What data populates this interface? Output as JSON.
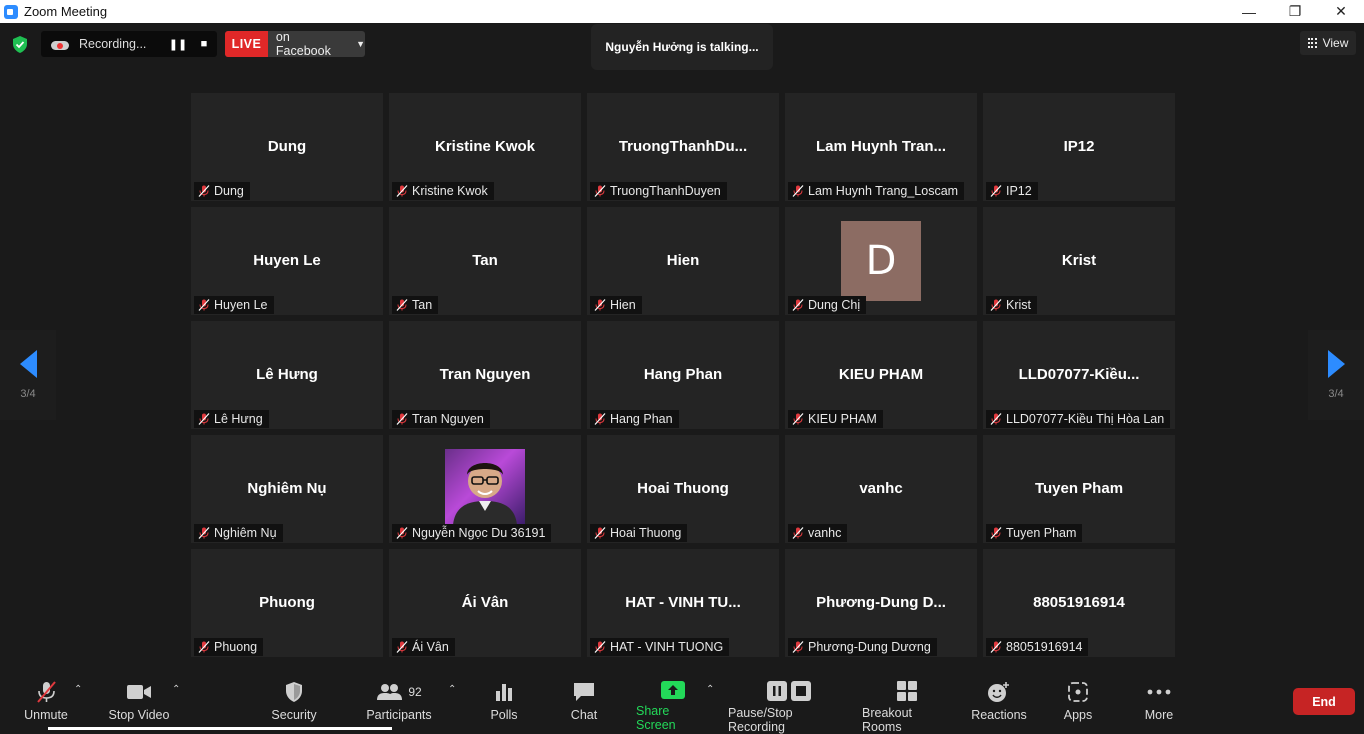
{
  "window": {
    "title": "Zoom Meeting"
  },
  "recording": {
    "label": "Recording..."
  },
  "live": {
    "tag": "LIVE",
    "destination": "on Facebook"
  },
  "talking": {
    "text": "Nguyễn Hưởng is talking..."
  },
  "view": {
    "label": "View"
  },
  "pagination": {
    "left": "3/4",
    "right": "3/4"
  },
  "participants": [
    {
      "name": "Dung",
      "label": "Dung"
    },
    {
      "name": "Kristine Kwok",
      "label": "Kristine Kwok"
    },
    {
      "name": "TruongThanhDu...",
      "label": "TruongThanhDuyen"
    },
    {
      "name": "Lam  Huynh  Tran...",
      "label": "Lam Huynh Trang_Loscam"
    },
    {
      "name": "IP12",
      "label": "IP12"
    },
    {
      "name": "Huyen Le",
      "label": "Huyen Le"
    },
    {
      "name": "Tan",
      "label": "Tan"
    },
    {
      "name": "Hien",
      "label": "Hien"
    },
    {
      "name": "",
      "label": "Dung Chị",
      "avatar_letter": "D"
    },
    {
      "name": "Krist",
      "label": "Krist"
    },
    {
      "name": "Lê Hưng",
      "label": "Lê Hưng"
    },
    {
      "name": "Tran Nguyen",
      "label": "Tran Nguyen"
    },
    {
      "name": "Hang Phan",
      "label": "Hang Phan"
    },
    {
      "name": "KIEU PHAM",
      "label": "KIEU PHAM"
    },
    {
      "name": "LLD07077-Kiều...",
      "label": "LLD07077-Kiều Thị Hòa Lan"
    },
    {
      "name": "Nghiêm Nụ",
      "label": "Nghiêm Nụ"
    },
    {
      "name": "",
      "label": "Nguyễn Ngọc Du 36191"
    },
    {
      "name": "Hoai Thuong",
      "label": "Hoai Thuong"
    },
    {
      "name": "vanhc",
      "label": "vanhc"
    },
    {
      "name": "Tuyen Pham",
      "label": "Tuyen Pham"
    },
    {
      "name": "Phuong",
      "label": "Phuong"
    },
    {
      "name": "Ái Vân",
      "label": "Ái Vân"
    },
    {
      "name": "HAT - VINH TU...",
      "label": "HAT - VINH TUONG"
    },
    {
      "name": "Phương-Dung  D...",
      "label": "Phương-Dung Dương"
    },
    {
      "name": "88051916914",
      "label": "88051916914"
    }
  ],
  "toolbar": {
    "unmute": "Unmute",
    "stop_video": "Stop Video",
    "security": "Security",
    "participants": "Participants",
    "participants_count": "92",
    "polls": "Polls",
    "chat": "Chat",
    "share_screen": "Share Screen",
    "pause_stop_recording": "Pause/Stop Recording",
    "breakout_rooms": "Breakout Rooms",
    "reactions": "Reactions",
    "apps": "Apps",
    "more": "More",
    "end": "End"
  },
  "colors": {
    "accent": "#2d8cff",
    "share_green": "#23d959",
    "end_red": "#c62424",
    "live_red": "#e02828",
    "muted_red": "#e0393e"
  },
  "icons": [
    "zoom-logo-icon",
    "shield-check-icon",
    "cloud-record-icon",
    "pause-icon",
    "stop-icon",
    "grid-view-icon",
    "prev-page-icon",
    "next-page-icon",
    "muted-mic-icon",
    "video-camera-icon",
    "security-shield-icon",
    "participants-icon",
    "polls-icon",
    "chat-icon",
    "share-screen-icon",
    "pause-recording-icon",
    "breakout-rooms-icon",
    "reactions-icon",
    "apps-icon",
    "more-icon"
  ]
}
